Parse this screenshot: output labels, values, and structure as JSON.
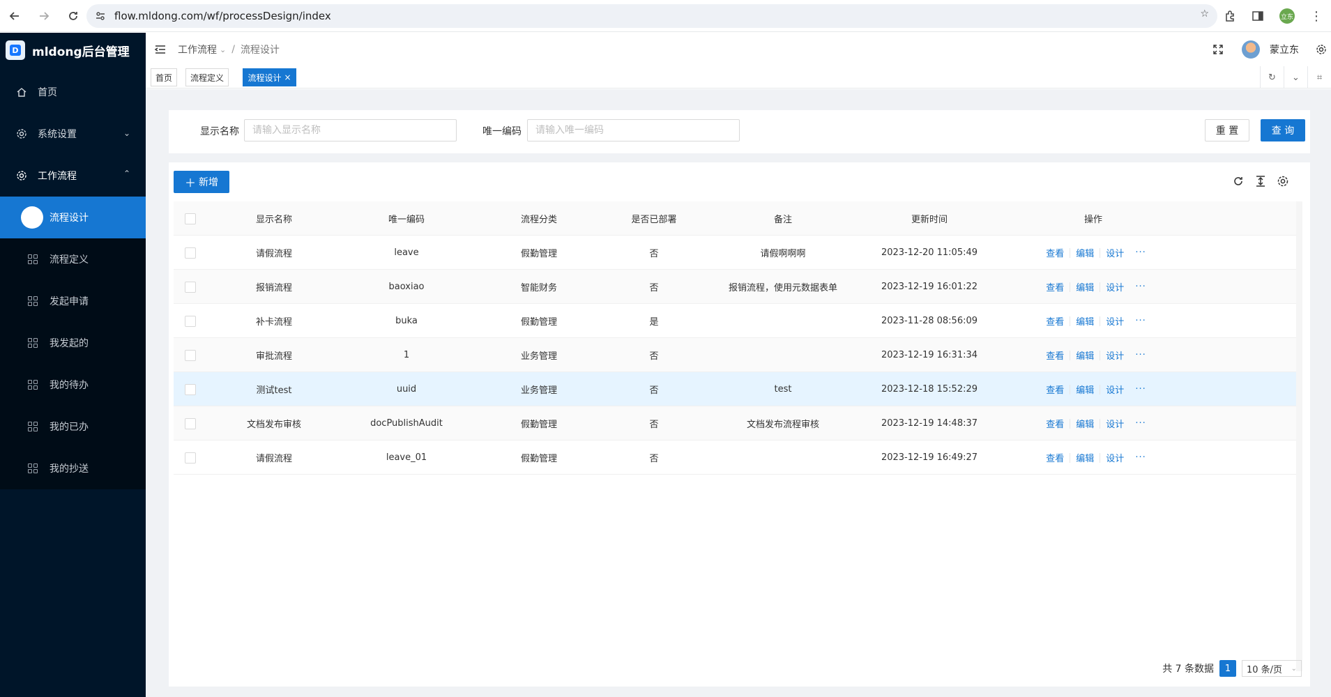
{
  "browser": {
    "url": "flow.mldong.com/wf/processDesign/index",
    "profile_label": "立东"
  },
  "sidebar": {
    "app_title": "mldong后台管理",
    "items": [
      {
        "label": "首页"
      },
      {
        "label": "系统设置"
      },
      {
        "label": "工作流程"
      }
    ],
    "sub_items": [
      {
        "label": "流程设计"
      },
      {
        "label": "流程定义"
      },
      {
        "label": "发起申请"
      },
      {
        "label": "我发起的"
      },
      {
        "label": "我的待办"
      },
      {
        "label": "我的已办"
      },
      {
        "label": "我的抄送"
      }
    ]
  },
  "header": {
    "breadcrumb_parent": "工作流程",
    "breadcrumb_current": "流程设计",
    "user_name": "蒙立东"
  },
  "tabs": [
    {
      "label": "首页"
    },
    {
      "label": "流程定义"
    },
    {
      "label": "流程设计"
    }
  ],
  "search": {
    "name_label": "显示名称",
    "name_placeholder": "请输入显示名称",
    "code_label": "唯一编码",
    "code_placeholder": "请输入唯一编码",
    "reset_label": "重 置",
    "query_label": "查 询"
  },
  "table": {
    "add_label": "新增",
    "columns": [
      "显示名称",
      "唯一编码",
      "流程分类",
      "是否已部署",
      "备注",
      "更新时间",
      "操作"
    ],
    "actions": {
      "view": "查看",
      "edit": "编辑",
      "design": "设计",
      "more": "···"
    },
    "rows": [
      {
        "name": "请假流程",
        "code": "leave",
        "category": "假勤管理",
        "deployed": "否",
        "remark": "请假啊啊啊",
        "updated": "2023-12-20 11:05:49"
      },
      {
        "name": "报销流程",
        "code": "baoxiao",
        "category": "智能财务",
        "deployed": "否",
        "remark": "报销流程，使用元数据表单",
        "updated": "2023-12-19 16:01:22"
      },
      {
        "name": "补卡流程",
        "code": "buka",
        "category": "假勤管理",
        "deployed": "是",
        "remark": "",
        "updated": "2023-11-28 08:56:09"
      },
      {
        "name": "审批流程",
        "code": "1",
        "category": "业务管理",
        "deployed": "否",
        "remark": "",
        "updated": "2023-12-19 16:31:34"
      },
      {
        "name": "测试test",
        "code": "uuid",
        "category": "业务管理",
        "deployed": "否",
        "remark": "test",
        "updated": "2023-12-18 15:52:29"
      },
      {
        "name": "文档发布审核",
        "code": "docPublishAudit",
        "category": "假勤管理",
        "deployed": "否",
        "remark": "文档发布流程审核",
        "updated": "2023-12-19 14:48:37"
      },
      {
        "name": "请假流程",
        "code": "leave_01",
        "category": "假勤管理",
        "deployed": "否",
        "remark": "",
        "updated": "2023-12-19 16:49:27"
      }
    ]
  },
  "pagination": {
    "total_text": "共 7 条数据",
    "current_page": "1",
    "page_size": "10 条/页"
  },
  "colors": {
    "primary": "#1677d2",
    "sidebar_bg": "#001529",
    "content_bg": "#f0f2f5"
  }
}
